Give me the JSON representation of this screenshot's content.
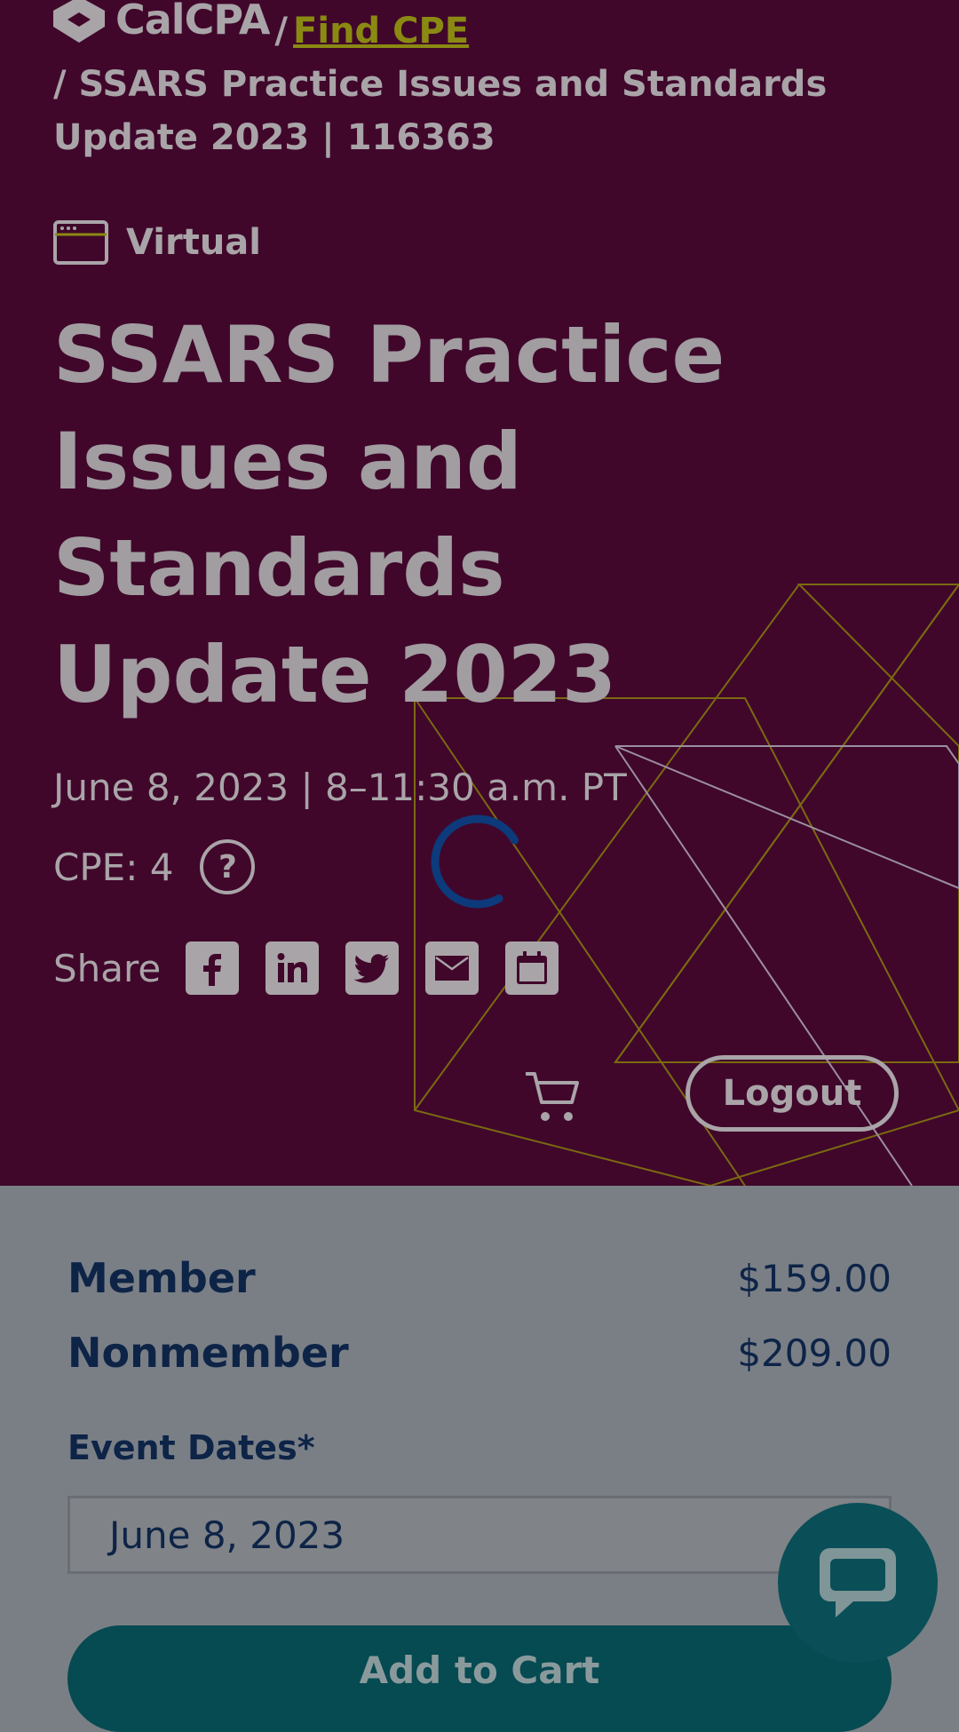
{
  "breadcrumb": {
    "logo_text": "CalCPA",
    "sep1": "/",
    "link": "Find CPE",
    "current": "/ SSARS Practice Issues and Standards Update 2023 | 116363"
  },
  "event": {
    "format": "Virtual",
    "format_icon": "browser-window-icon",
    "title": "SSARS Practice Issues and Standards Update 2023",
    "date_time": "June 8, 2023 | 8–11:30 a.m. PT",
    "cpe_label": "CPE: 4",
    "help_icon": "question-circle-icon",
    "help_glyph": "?"
  },
  "share": {
    "label": "Share",
    "buttons": [
      "facebook-icon",
      "linkedin-icon",
      "twitter-icon",
      "email-icon",
      "calendar-icon"
    ]
  },
  "header_actions": {
    "cart_icon": "cart-icon",
    "logout_label": "Logout"
  },
  "pricing": {
    "member_label": "Member",
    "member_price": "$159.00",
    "nonmember_label": "Nonmember",
    "nonmember_price": "$209.00"
  },
  "event_dates": {
    "label": "Event Dates*",
    "selected": "June 8, 2023"
  },
  "add_to_cart_label": "Add to Cart",
  "chat_icon": "chat-bubble-icon",
  "loading_icon": "loading-spinner-icon",
  "colors": {
    "hero_bg": "#40072b",
    "link": "#8a8a12",
    "panel_text": "#0d2447",
    "button_bg": "#064a52"
  }
}
